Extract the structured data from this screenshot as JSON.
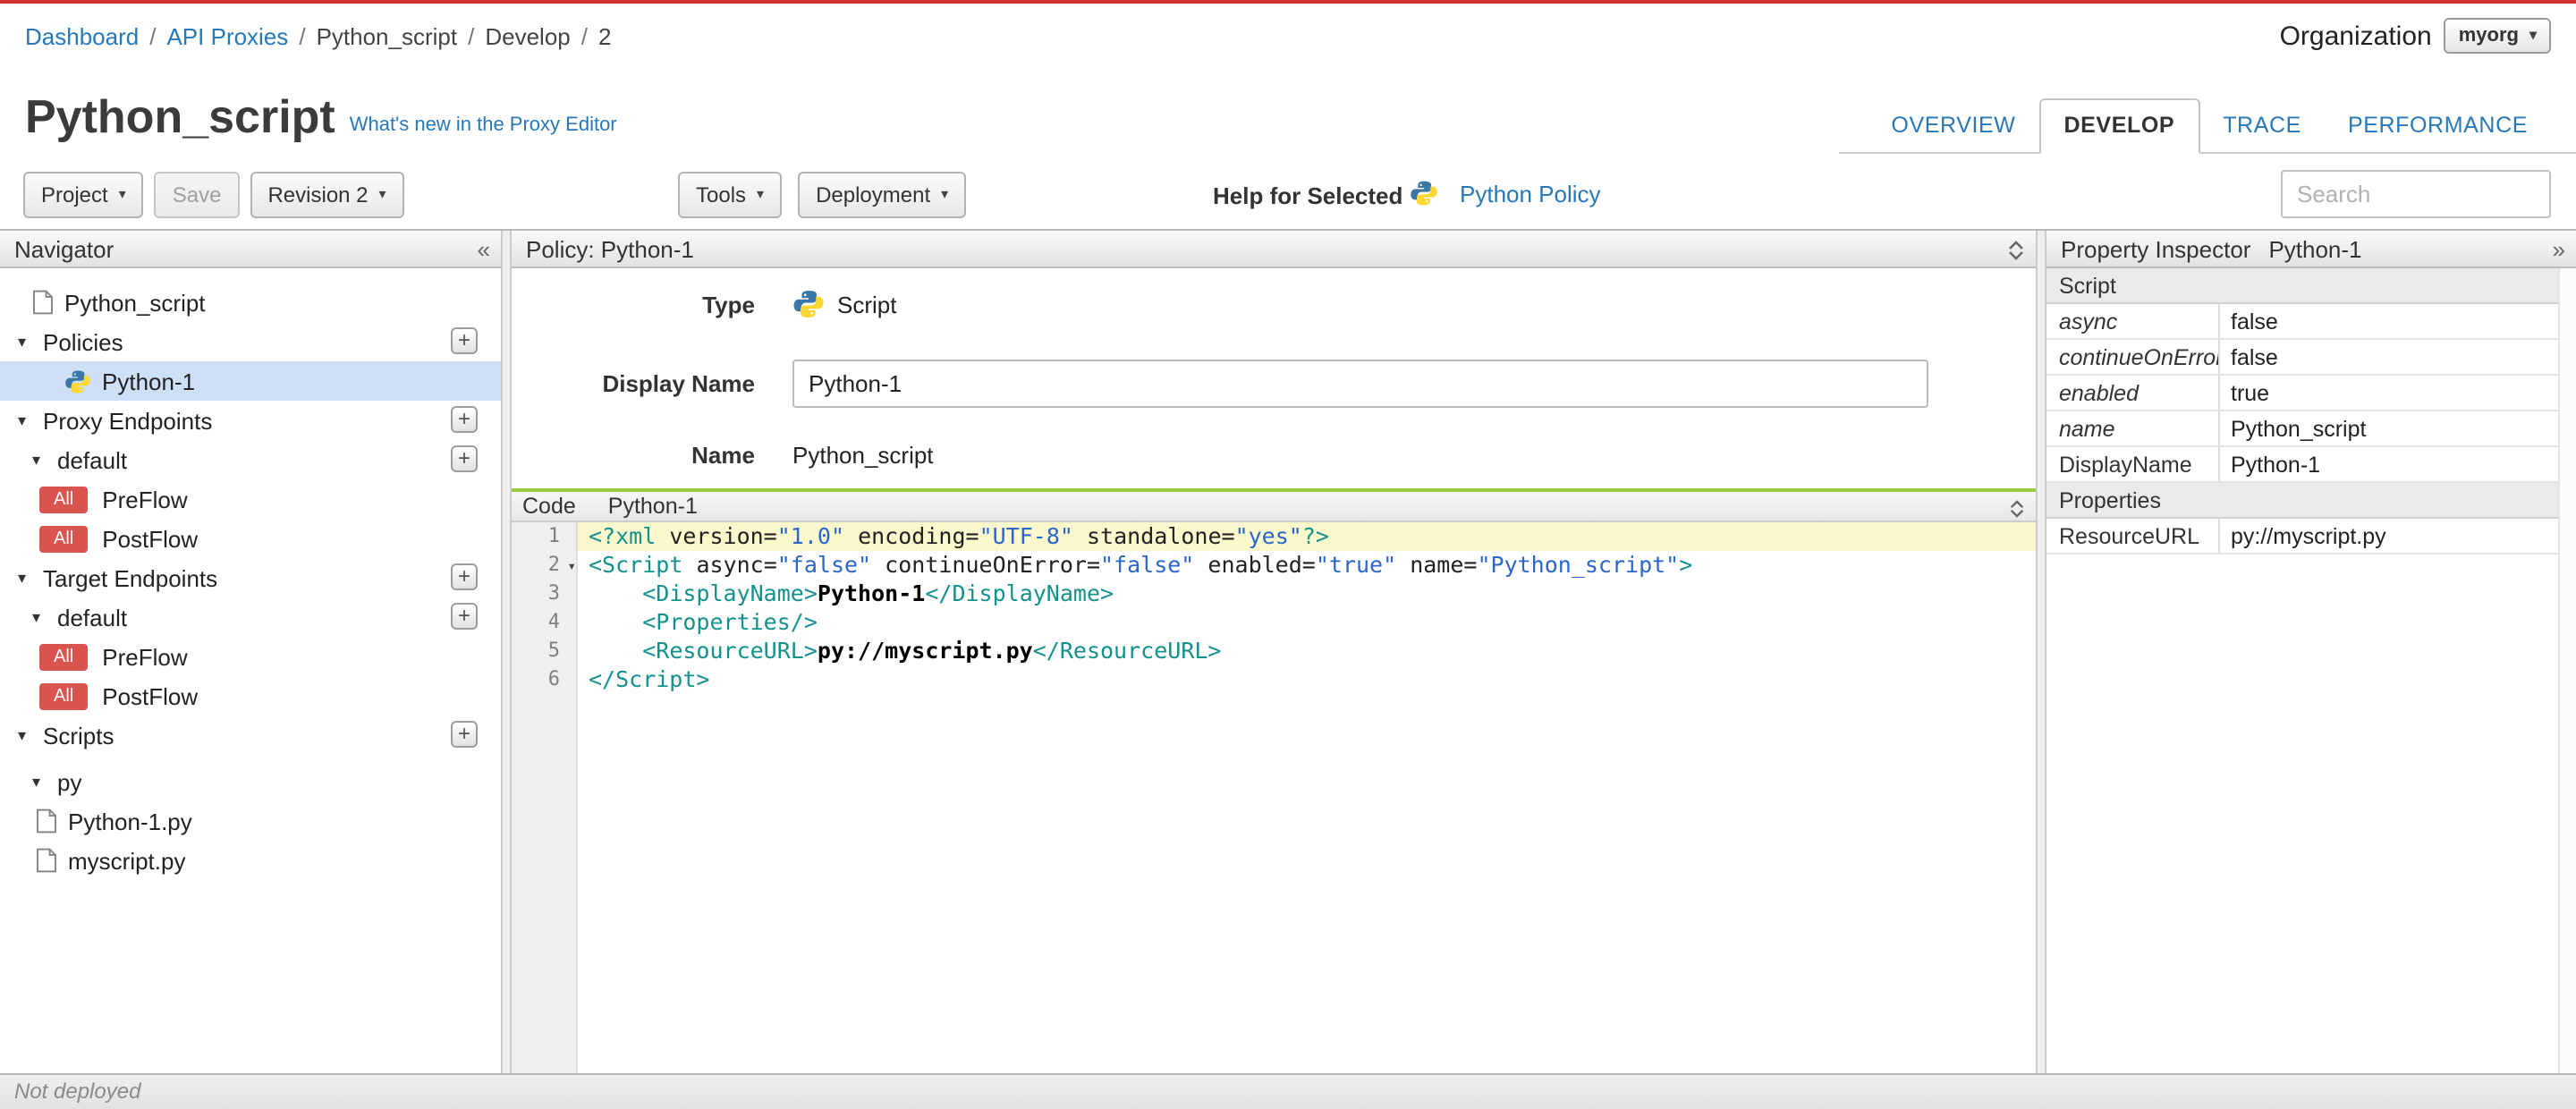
{
  "page": {
    "accent_red": "#d42f2f",
    "link_blue": "#2878b8",
    "selected_row_blue": "#cde0f6",
    "badge_red": "#d9534f",
    "code_panel_green": "#9ccc3d"
  },
  "breadcrumb": {
    "separator": "/",
    "items": [
      {
        "label": "Dashboard",
        "link": true
      },
      {
        "label": "API Proxies",
        "link": true
      },
      {
        "label": "Python_script",
        "link": false
      },
      {
        "label": "Develop",
        "link": false
      },
      {
        "label": "2",
        "link": false
      }
    ]
  },
  "organization": {
    "label": "Organization",
    "value": "myorg"
  },
  "header": {
    "title": "Python_script",
    "whats_new": "What's new in the Proxy Editor",
    "tabs": [
      {
        "label": "OVERVIEW",
        "active": false
      },
      {
        "label": "DEVELOP",
        "active": true
      },
      {
        "label": "TRACE",
        "active": false
      },
      {
        "label": "PERFORMANCE",
        "active": false
      }
    ]
  },
  "toolbar": {
    "project": "Project",
    "save": "Save",
    "revision": "Revision 2",
    "tools": "Tools",
    "deployment": "Deployment",
    "help_for_selected": "Help for Selected",
    "policy_help_link": "Python Policy",
    "search_placeholder": "Search"
  },
  "navigator": {
    "title": "Navigator",
    "collapse_icon": "«",
    "add_button": "+",
    "all_badge": "All",
    "root": "Python_script",
    "policies_label": "Policies",
    "policy_python1": "Python-1",
    "proxy_endpoints_label": "Proxy Endpoints",
    "proxy_default": "default",
    "proxy_preflow": "PreFlow",
    "proxy_postflow": "PostFlow",
    "target_endpoints_label": "Target Endpoints",
    "target_default": "default",
    "target_preflow": "PreFlow",
    "target_postflow": "PostFlow",
    "scripts_label": "Scripts",
    "scripts_group": "py",
    "script_file_1": "Python-1.py",
    "script_file_2": "myscript.py"
  },
  "policy_panel": {
    "header": "Policy: Python-1",
    "type_label": "Type",
    "type_value": "Script",
    "display_name_label": "Display Name",
    "display_name_value": "Python-1",
    "name_label": "Name",
    "name_value": "Python_script"
  },
  "code": {
    "panel_label": "Code",
    "panel_title": "Python-1",
    "lines": [
      {
        "num": 1,
        "active": true,
        "tokens": [
          [
            "tag",
            "<?xml "
          ],
          [
            "attr",
            "version="
          ],
          [
            "str",
            "\"1.0\""
          ],
          [
            "attr",
            " encoding="
          ],
          [
            "str",
            "\"UTF-8\""
          ],
          [
            "attr",
            " standalone="
          ],
          [
            "str",
            "\"yes\""
          ],
          [
            "tag",
            "?>"
          ]
        ]
      },
      {
        "num": 2,
        "fold": true,
        "tokens": [
          [
            "tag",
            "<Script "
          ],
          [
            "attr",
            "async="
          ],
          [
            "str",
            "\"false\""
          ],
          [
            "attr",
            " continueOnError="
          ],
          [
            "str",
            "\"false\""
          ],
          [
            "attr",
            " enabled="
          ],
          [
            "str",
            "\"true\""
          ],
          [
            "attr",
            " name="
          ],
          [
            "str",
            "\"Python_script\""
          ],
          [
            "tag",
            ">"
          ]
        ]
      },
      {
        "num": 3,
        "tokens": [
          [
            "text",
            "    "
          ],
          [
            "tag",
            "<DisplayName>"
          ],
          [
            "bold",
            "Python-1"
          ],
          [
            "tag",
            "</DisplayName>"
          ]
        ]
      },
      {
        "num": 4,
        "tokens": [
          [
            "text",
            "    "
          ],
          [
            "tag",
            "<Properties/>"
          ]
        ]
      },
      {
        "num": 5,
        "tokens": [
          [
            "text",
            "    "
          ],
          [
            "tag",
            "<ResourceURL>"
          ],
          [
            "bold",
            "py://myscript.py"
          ],
          [
            "tag",
            "</ResourceURL>"
          ]
        ]
      },
      {
        "num": 6,
        "tokens": [
          [
            "tag",
            "</Script>"
          ]
        ]
      }
    ]
  },
  "inspector": {
    "title": "Property Inspector",
    "subtitle": "Python-1",
    "expand_icon": "»",
    "sections": [
      {
        "header": "Script",
        "rows": [
          {
            "label": "async",
            "value": "false",
            "italic": true
          },
          {
            "label": "continueOnError",
            "value": "false",
            "italic": true
          },
          {
            "label": "enabled",
            "value": "true",
            "italic": true
          },
          {
            "label": "name",
            "value": "Python_script",
            "italic": true
          },
          {
            "label": "DisplayName",
            "value": "Python-1",
            "italic": false
          }
        ]
      },
      {
        "header": "Properties",
        "rows": [
          {
            "label": "ResourceURL",
            "value": "py://myscript.py",
            "italic": false
          }
        ]
      }
    ]
  },
  "statusbar": {
    "text": "Not deployed"
  }
}
